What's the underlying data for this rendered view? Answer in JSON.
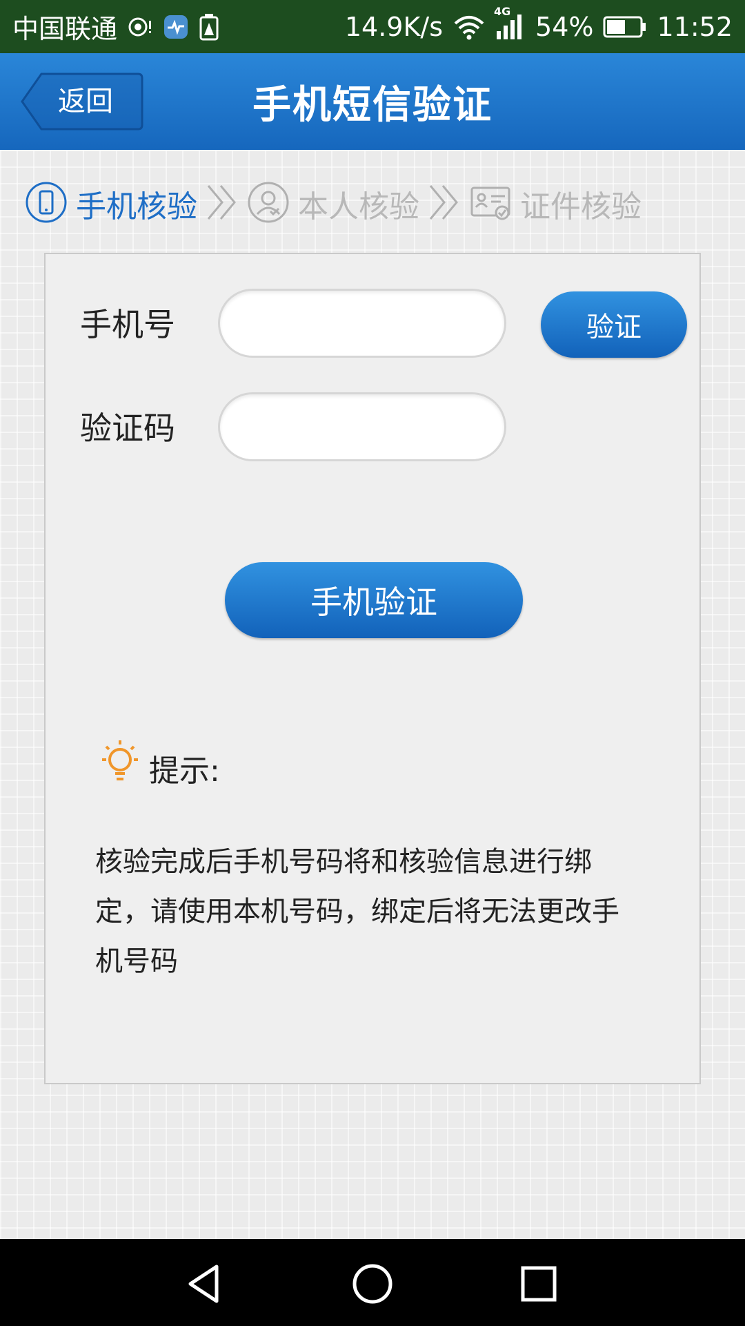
{
  "status_bar": {
    "carrier": "中国联通",
    "speed": "14.9K/s",
    "network": "4G",
    "battery": "54%",
    "time": "11:52",
    "icons": [
      "hotspot-icon",
      "health-app-icon",
      "battery-saver-icon",
      "wifi-icon",
      "signal-icon",
      "battery-icon"
    ]
  },
  "header": {
    "back_label": "返回",
    "title": "手机短信验证"
  },
  "steps": [
    {
      "label": "手机核验",
      "icon": "phone-icon",
      "state": "active"
    },
    {
      "label": "本人核验",
      "icon": "person-icon",
      "state": "inactive"
    },
    {
      "label": "证件核验",
      "icon": "id-card-icon",
      "state": "inactive"
    }
  ],
  "form": {
    "phone_label": "手机号",
    "phone_value": "",
    "code_label": "验证码",
    "code_value": "",
    "verify_button": "验证",
    "submit_button": "手机验证"
  },
  "hint": {
    "title": "提示:",
    "body": "核验完成后手机号码将和核验信息进行绑定，请使用本机号码，绑定后将无法更改手机号码"
  },
  "colors": {
    "accent": "#1e6ec6",
    "header": "#1a73c9",
    "hint_icon": "#f0962a",
    "status_bar": "#1d4d1f"
  },
  "nav_bar": {
    "icons": [
      "back-triangle-icon",
      "home-circle-icon",
      "recents-square-icon"
    ]
  }
}
